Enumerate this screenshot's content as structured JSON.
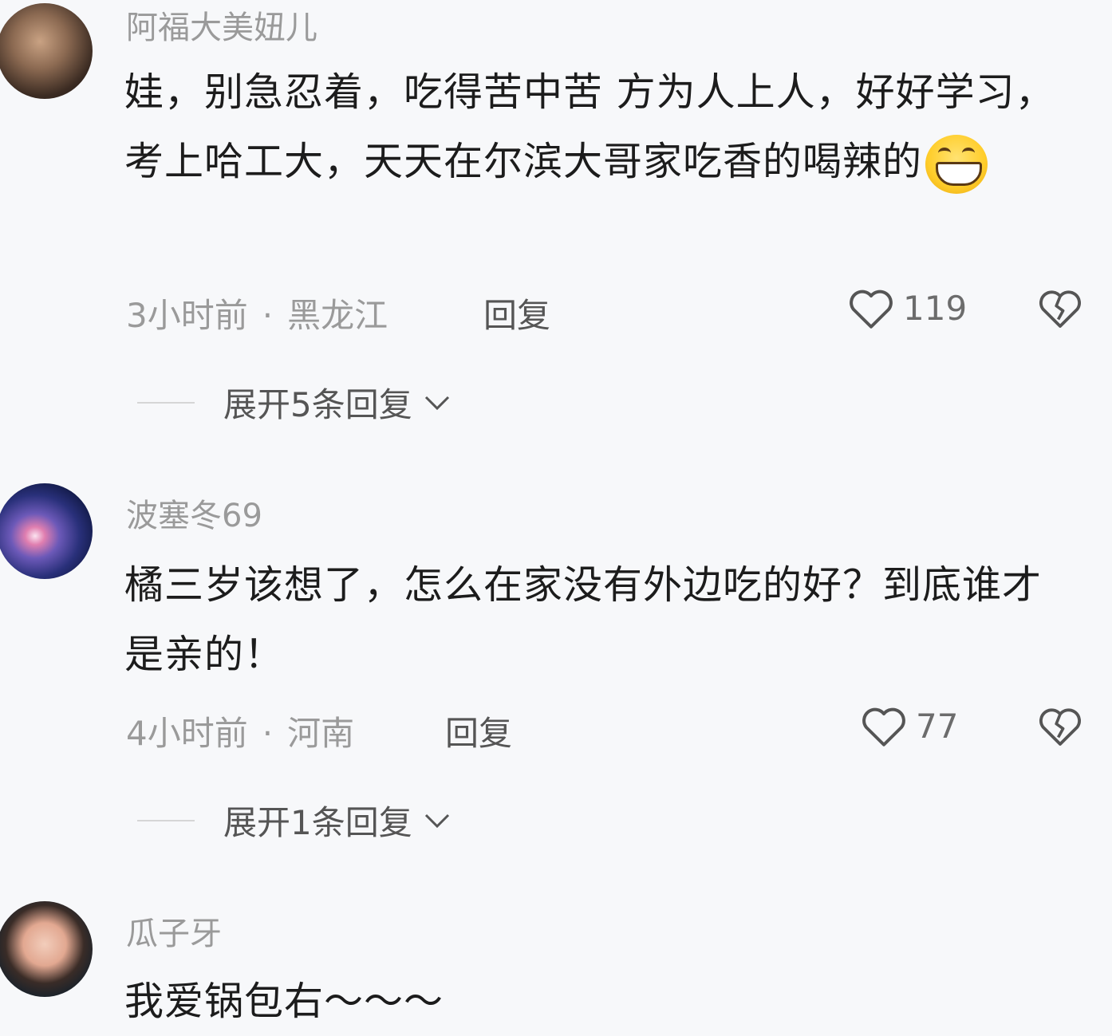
{
  "comments": [
    {
      "username": "阿福大美妞儿",
      "text": "娃，别急忍着，吃得苦中苦 方为人上人，好好学习，考上哈工大，天天在尔滨大哥家吃香的喝辣的",
      "emoji": "grinning-face-emoji",
      "time": "3小时前",
      "separator": "·",
      "location": "黑龙江",
      "reply_label": "回复",
      "likes": "119",
      "expand_label": "展开5条回复"
    },
    {
      "username": "波塞冬69",
      "text": "橘三岁该想了，怎么在家没有外边吃的好？到底谁才是亲的！",
      "time": "4小时前",
      "separator": "·",
      "location": "河南",
      "reply_label": "回复",
      "likes": "77",
      "expand_label": "展开1条回复"
    },
    {
      "username": "瓜子牙",
      "text": "我爱锅包右～～～"
    }
  ],
  "icons": {
    "like": "heart-outline-icon",
    "dislike": "broken-heart-icon",
    "expand": "chevron-down-icon"
  },
  "colors": {
    "background": "#f7f8fa",
    "username": "#9a9a9a",
    "text": "#1c1c1c"
  }
}
